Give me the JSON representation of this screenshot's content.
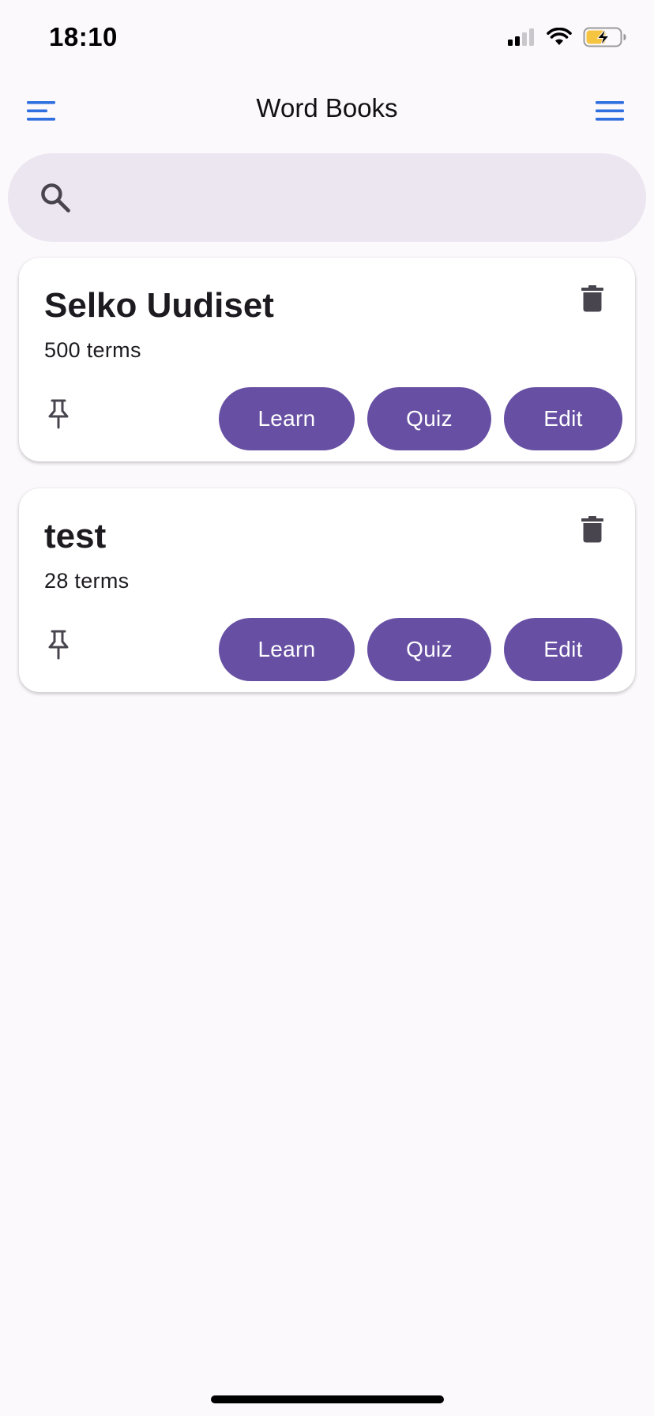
{
  "status_bar": {
    "time": "18:10",
    "icons": [
      "cellular-signal-icon",
      "wifi-icon",
      "battery-charging-icon"
    ]
  },
  "app_bar": {
    "title": "Word Books",
    "left_icon": "menu-icon",
    "right_icon": "menu-icon"
  },
  "search": {
    "value": "",
    "placeholder": "",
    "icon": "search-icon"
  },
  "books": [
    {
      "title": "Selko Uudiset",
      "subtitle": "500 terms",
      "learn_label": "Learn",
      "quiz_label": "Quiz",
      "edit_label": "Edit"
    },
    {
      "title": "test",
      "subtitle": "28 terms",
      "learn_label": "Learn",
      "quiz_label": "Quiz",
      "edit_label": "Edit"
    }
  ],
  "colors": {
    "accent": "#6750a4",
    "menu_icon": "#2f6fe0",
    "background": "#fcf9fd",
    "search_background": "#ece6f0"
  }
}
